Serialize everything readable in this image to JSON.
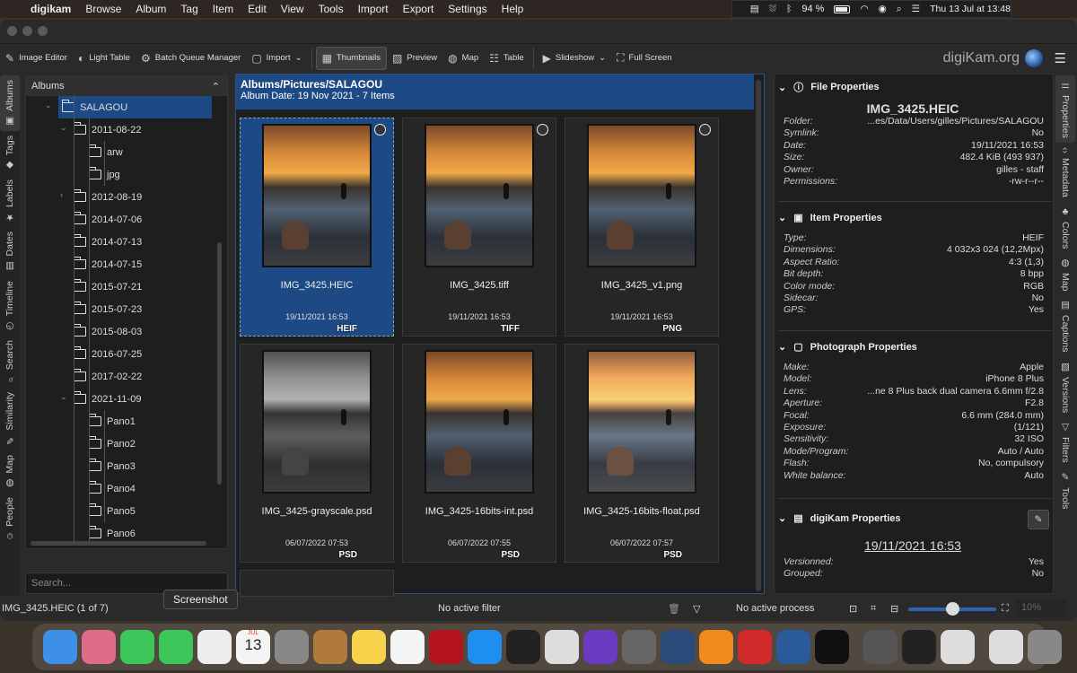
{
  "menubar": {
    "app": "digikam",
    "items": [
      "Browse",
      "Album",
      "Tag",
      "Item",
      "Edit",
      "View",
      "Tools",
      "Import",
      "Export",
      "Settings",
      "Help"
    ],
    "battery": "94 %",
    "clock": "Thu 13 Jul at 13:48"
  },
  "toolbar": {
    "image_editor": "Image Editor",
    "light_table": "Light Table",
    "bqm": "Batch Queue Manager",
    "import": "Import",
    "thumbnails": "Thumbnails",
    "preview": "Preview",
    "map": "Map",
    "table": "Table",
    "slideshow": "Slideshow",
    "full_screen": "Full Screen",
    "brand": "digiKam.org"
  },
  "left_tabs": [
    "Albums",
    "Tags",
    "Labels",
    "Dates",
    "Timeline",
    "Search",
    "Similarity",
    "Map",
    "People"
  ],
  "albums": {
    "title": "Albums",
    "search_placeholder": "Search...",
    "tree": [
      {
        "label": "SALAGOU",
        "level": 0,
        "expanded": true,
        "selected": true
      },
      {
        "label": "2011-08-22",
        "level": 1,
        "expanded": true
      },
      {
        "label": "arw",
        "level": 2
      },
      {
        "label": "jpg",
        "level": 2
      },
      {
        "label": "2012-08-19",
        "level": 1,
        "collapsed": true
      },
      {
        "label": "2014-07-06",
        "level": 1
      },
      {
        "label": "2014-07-13",
        "level": 1
      },
      {
        "label": "2014-07-15",
        "level": 1
      },
      {
        "label": "2015-07-21",
        "level": 1
      },
      {
        "label": "2015-07-23",
        "level": 1
      },
      {
        "label": "2015-08-03",
        "level": 1
      },
      {
        "label": "2016-07-25",
        "level": 1
      },
      {
        "label": "2017-02-22",
        "level": 1
      },
      {
        "label": "2021-11-09",
        "level": 1,
        "expanded": true
      },
      {
        "label": "Pano1",
        "level": 2
      },
      {
        "label": "Pano2",
        "level": 2
      },
      {
        "label": "Pano3",
        "level": 2
      },
      {
        "label": "Pano4",
        "level": 2
      },
      {
        "label": "Pano5",
        "level": 2
      },
      {
        "label": "Pano6",
        "level": 2
      }
    ]
  },
  "main": {
    "path": "Albums/Pictures/SALAGOU",
    "subtitle": "Album Date: 19 Nov 2021 - 7 Items",
    "items": [
      {
        "name": "IMG_3425.HEIC",
        "date": "19/11/2021 16:53",
        "format": "HEIF",
        "selected": true,
        "gps": true
      },
      {
        "name": "IMG_3425.tiff",
        "date": "19/11/2021 16:53",
        "format": "TIFF",
        "gps": true
      },
      {
        "name": "IMG_3425_v1.png",
        "date": "19/11/2021 16:53",
        "format": "PNG",
        "gps": true
      },
      {
        "name": "IMG_3425-grayscale.psd",
        "date": "06/07/2022 07:53",
        "format": "PSD",
        "style": "gray"
      },
      {
        "name": "IMG_3425-16bits-int.psd",
        "date": "06/07/2022 07:55",
        "format": "PSD"
      },
      {
        "name": "IMG_3425-16bits-float.psd",
        "date": "06/07/2022 07:57",
        "format": "PSD",
        "style": "light"
      }
    ]
  },
  "properties": {
    "file": {
      "title": "File Properties",
      "filename": "IMG_3425.HEIC",
      "rows": [
        [
          "Folder:",
          "...es/Data/Users/gilles/Pictures/SALAGOU"
        ],
        [
          "Symlink:",
          "No"
        ],
        [
          "Date:",
          "19/11/2021 16:53"
        ],
        [
          "Size:",
          "482.4 KiB (493 937)"
        ],
        [
          "Owner:",
          "gilles - staff"
        ],
        [
          "Permissions:",
          "-rw-r--r--"
        ]
      ]
    },
    "item": {
      "title": "Item Properties",
      "rows": [
        [
          "Type:",
          "HEIF"
        ],
        [
          "Dimensions:",
          "4 032x3 024 (12,2Mpx)"
        ],
        [
          "Aspect Ratio:",
          "4:3 (1,3)"
        ],
        [
          "Bit depth:",
          "8 bpp"
        ],
        [
          "Color mode:",
          "RGB"
        ],
        [
          "Sidecar:",
          "No"
        ],
        [
          "GPS:",
          "Yes"
        ]
      ]
    },
    "photo": {
      "title": "Photograph Properties",
      "rows": [
        [
          "Make:",
          "Apple"
        ],
        [
          "Model:",
          "iPhone 8 Plus"
        ],
        [
          "Lens:",
          "...ne 8 Plus back dual camera 6.6mm f/2.8"
        ],
        [
          "Aperture:",
          "F2.8"
        ],
        [
          "Focal:",
          "6.6 mm (284.0 mm)"
        ],
        [
          "Exposure:",
          "(1/121)"
        ],
        [
          "Sensitivity:",
          "32 ISO"
        ],
        [
          "Mode/Program:",
          "Auto / Auto"
        ],
        [
          "Flash:",
          "No, compulsory"
        ],
        [
          "White balance:",
          "Auto"
        ]
      ]
    },
    "digikam": {
      "title": "digiKam Properties",
      "date": "19/11/2021 16:53",
      "rows": [
        [
          "Versionned:",
          "Yes"
        ],
        [
          "Grouped:",
          "No"
        ]
      ]
    }
  },
  "right_tabs": [
    "Properties",
    "Metadata",
    "Colors",
    "Map",
    "Captions",
    "Versions",
    "Filters",
    "Tools"
  ],
  "status": {
    "item": "IMG_3425.HEIC (1 of 7)",
    "filter": "No active filter",
    "process": "No active process",
    "zoom": "10%",
    "zoom_fraction": 0.5,
    "tooltip": "Screenshot"
  },
  "dock": {
    "calendar_month": "JUL",
    "calendar_day": "13",
    "colors": [
      "#3d8fe8",
      "#e06a8a",
      "#3dc75a",
      "#3dc75a",
      "#eeeeee",
      "#f4f4f4",
      "#888888",
      "#b07a3a",
      "#f7d24a",
      "#f4f4f4",
      "#b3131a",
      "#1e8ef0",
      "#222222",
      "#dddddd",
      "#6a3ac0",
      "#666666",
      "#2a4a7a",
      "#f08a1a",
      "#d02a2a",
      "#2a5a9a",
      "#111111",
      "#555555",
      "#222222",
      "#dddddd",
      "#dddddd",
      "#888888"
    ]
  }
}
